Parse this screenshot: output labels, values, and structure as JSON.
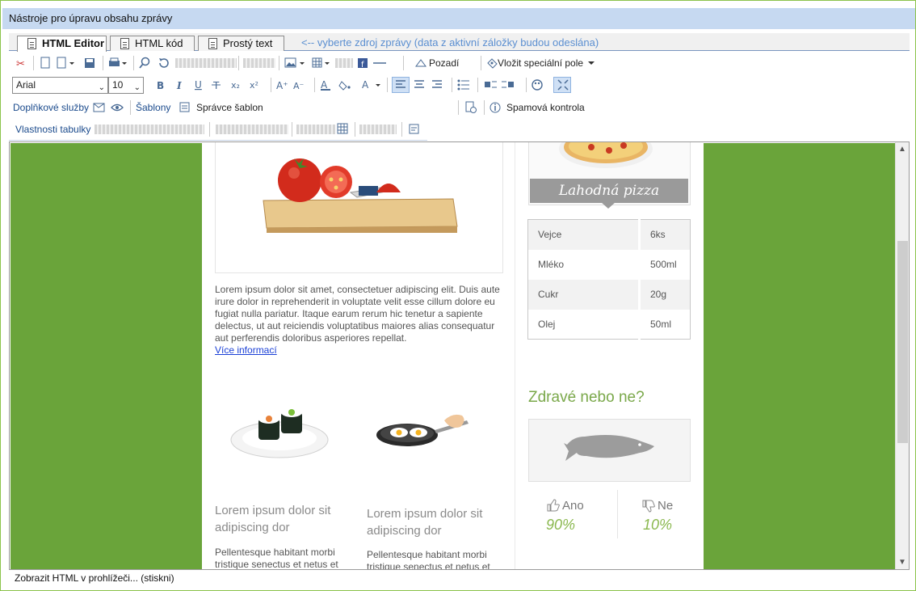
{
  "window": {
    "title": "Nástroje pro úpravu obsahu zprávy"
  },
  "tabs": [
    {
      "label": "HTML Editor"
    },
    {
      "label": "HTML kód"
    },
    {
      "label": "Prostý text"
    }
  ],
  "tab_hint": "<-- vyberte zdroj zprávy (data z aktivní záložky budou odeslána)",
  "toolbar1": {
    "background_label": "Pozadí",
    "special_field_label": "Vložit speciální pole"
  },
  "toolbar2": {
    "font_value": "Arial",
    "size_value": "10"
  },
  "toolbar3": {
    "services_label": "Doplňkové služby",
    "templates_label": "Šablony",
    "template_manager_label": "Správce šablon",
    "spam_check_label": "Spamová kontrola"
  },
  "toolbar4": {
    "table_props_label": "Vlastnosti tabulky"
  },
  "content": {
    "main_paragraph": "Lorem ipsum dolor sit amet, consectetuer adipiscing elit. Duis aute irure dolor in reprehenderit in voluptate velit esse cillum dolore eu fugiat nulla pariatur. Itaque earum rerum hic tenetur a sapiente delectus, ut aut reiciendis voluptatibus maiores alias consequatur aut perferendis doloribus asperiores repellat.",
    "more_link": "Více informací",
    "card1_title": "Lorem ipsum dolor sit adipiscing dor",
    "card1_text": "Pellentesque habitant morbi tristique senectus et netus et",
    "card2_title": "Lorem ipsum dolor sit adipiscing dor",
    "card2_text": "Pellentesque habitant morbi tristique senectus et netus et",
    "pizza_caption": "Lahodná pizza",
    "ingredients": [
      {
        "name": "Vejce",
        "amount": "6ks"
      },
      {
        "name": "Mléko",
        "amount": "500ml"
      },
      {
        "name": "Cukr",
        "amount": "20g"
      },
      {
        "name": "Olej",
        "amount": "50ml"
      }
    ],
    "poll_title": "Zdravé nebo ne?",
    "poll_yes_label": "Ano",
    "poll_yes_value": "90%",
    "poll_no_label": "Ne",
    "poll_no_value": "10%"
  },
  "status_bar": "Zobrazit HTML v prohlížeči... (stiskni)",
  "colors": {
    "accent_green": "#6aa43a",
    "title_bar": "#c6d9f1",
    "poll_green": "#8ab84e"
  }
}
